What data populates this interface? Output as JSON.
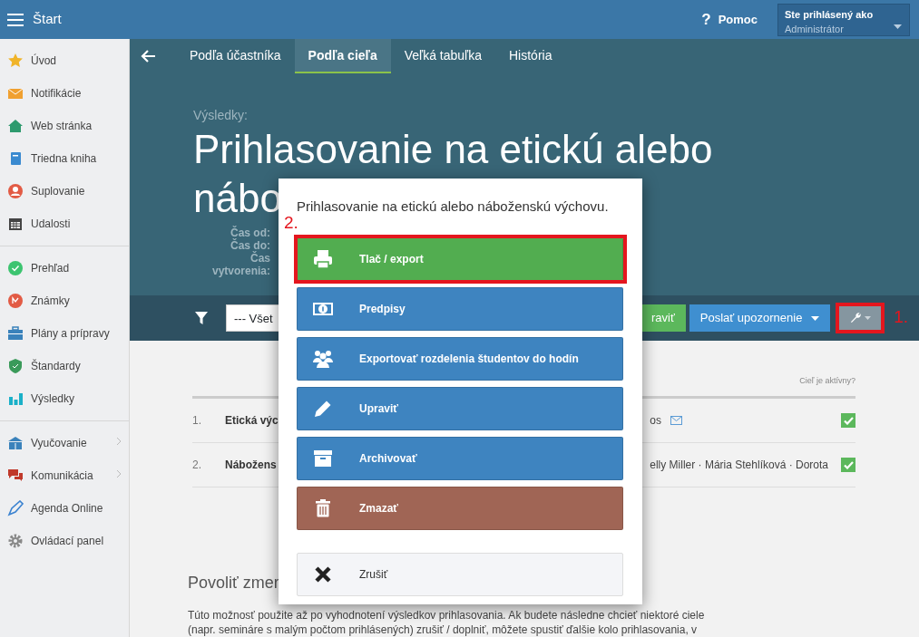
{
  "topbar": {
    "title": "Štart",
    "help_icon": "?",
    "help": "Pomoc",
    "user_label": "Ste prihlásený ako",
    "user_name": "Administrátor"
  },
  "sidebar": {
    "groups": [
      [
        {
          "label": "Úvod",
          "has_submenu": false
        },
        {
          "label": "Notifikácie",
          "has_submenu": false
        },
        {
          "label": "Web stránka",
          "has_submenu": false
        },
        {
          "label": "Triedna kniha",
          "has_submenu": false
        },
        {
          "label": "Suplovanie",
          "has_submenu": false
        },
        {
          "label": "Udalosti",
          "has_submenu": false
        }
      ],
      [
        {
          "label": "Prehľad",
          "has_submenu": false
        },
        {
          "label": "Známky",
          "has_submenu": false
        },
        {
          "label": "Plány a prípravy",
          "has_submenu": false
        },
        {
          "label": "Štandardy",
          "has_submenu": false
        },
        {
          "label": "Výsledky",
          "has_submenu": false
        }
      ],
      [
        {
          "label": "Vyučovanie",
          "has_submenu": true
        },
        {
          "label": "Komunikácia",
          "has_submenu": true
        },
        {
          "label": "Agenda Online",
          "has_submenu": false
        },
        {
          "label": "Ovládací panel",
          "has_submenu": false
        }
      ]
    ]
  },
  "tabs": [
    {
      "label": "Podľa účastníka",
      "selected": false
    },
    {
      "label": "Podľa cieľa",
      "selected": true
    },
    {
      "label": "Veľká tabuľka",
      "selected": false
    },
    {
      "label": "História",
      "selected": false
    }
  ],
  "header": {
    "overline": "Výsledky:",
    "title_lines": [
      "Prihlasovanie na etickú alebo",
      "nábo"
    ],
    "meta_labels": [
      "Čas od:",
      "Čas do:",
      "Čas vytvorenia:"
    ]
  },
  "toolbar": {
    "filter_value": "--- Všet",
    "edit_button": "raviť",
    "notify_button": "Poslať upozornenie",
    "tools_annotation": "1."
  },
  "table": {
    "column_header": "Cieľ je aktívny?",
    "rows": [
      {
        "number": "1.",
        "name": "Etická výc",
        "participants": "os",
        "has_mail": true,
        "active": true
      },
      {
        "number": "2.",
        "name": "Nábožens",
        "participants": "elly Miller · Mária Stehlíková · Dorota",
        "has_mail": false,
        "active": true
      }
    ]
  },
  "section": {
    "title": "Povoliť zmer",
    "lines": [
      "Túto možnosť použite až po vyhodnotení výsledkov prihlasovania. Ak budete následne chcieť niektoré ciele",
      "(napr. semináre s malým počtom prihlásených) zrušiť / doplniť, môžete spustiť ďalšie kolo prihlasovania, v"
    ]
  },
  "modal": {
    "title": "Prihlasovanie na etickú alebo náboženskú výchovu.",
    "actions": [
      {
        "label": "Tlač / export",
        "kind": "success",
        "annotation": "2."
      },
      {
        "label": "Predpisy",
        "kind": "primary"
      },
      {
        "label": "Exportovať rozdelenia študentov do hodín",
        "kind": "primary"
      },
      {
        "label": "Upraviť",
        "kind": "primary"
      },
      {
        "label": "Archivovať",
        "kind": "primary"
      },
      {
        "label": "Zmazať",
        "kind": "danger"
      }
    ],
    "cancel": {
      "label": "Zrušiť",
      "kind": "light"
    }
  }
}
